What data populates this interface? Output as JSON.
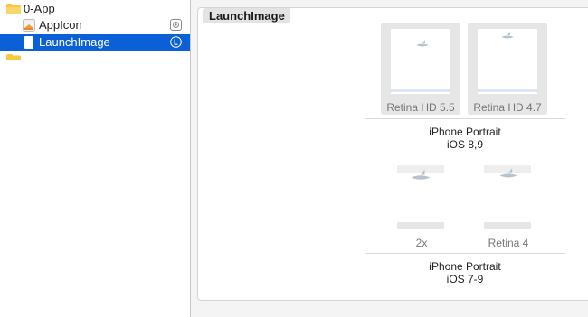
{
  "navigator": {
    "items": [
      {
        "label": "0-App",
        "icon": "folder-icon"
      },
      {
        "label": "AppIcon",
        "icon": "appicon-icon",
        "badge": "appicon-badge-icon"
      },
      {
        "label": "LaunchImage",
        "icon": "launch-image-icon",
        "badge": "info-icon",
        "selected": true
      }
    ],
    "selection_color": "#0b60d8"
  },
  "editor": {
    "title": "LaunchImage",
    "groups": [
      {
        "name": "iPhone Portrait",
        "os": "iOS 8,9",
        "slots": [
          {
            "label": "Retina HD 5.5"
          },
          {
            "label": "Retina HD 4.7"
          }
        ]
      },
      {
        "name": "iPhone Portrait",
        "os": "iOS 7-9",
        "slots": [
          {
            "label": "2x"
          },
          {
            "label": "Retina 4"
          }
        ]
      }
    ]
  }
}
